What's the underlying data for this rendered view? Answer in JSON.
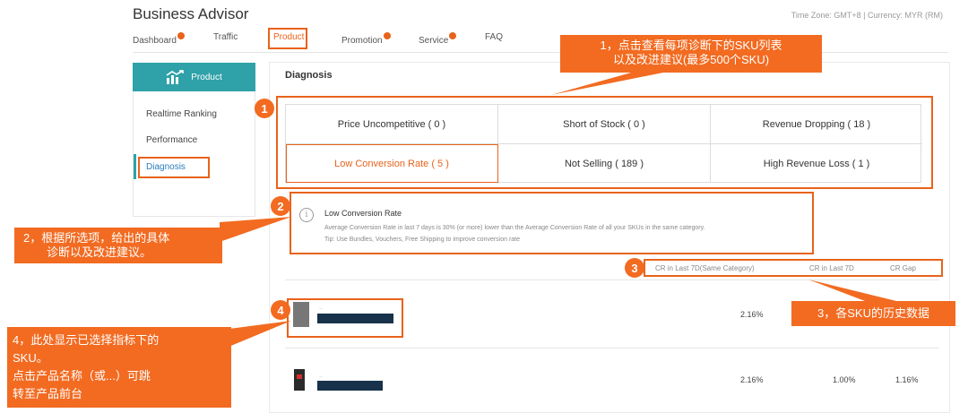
{
  "header": {
    "title": "Business Advisor",
    "meta": "Time Zone: GMT+8 | Currency: MYR (RM)"
  },
  "nav": {
    "dashboard": "Dashboard",
    "traffic": "Traffic",
    "product": "Product",
    "promotion": "Promotion",
    "service": "Service",
    "faq": "FAQ"
  },
  "sidebar": {
    "head": "Product",
    "items": [
      "Realtime Ranking",
      "Performance",
      "Diagnosis"
    ]
  },
  "main": {
    "title": "Diagnosis",
    "cells": [
      "Price Uncompetitive ( 0 )",
      "Short of Stock ( 0 )",
      "Revenue Dropping ( 18 )",
      "Low Conversion Rate ( 5 )",
      "Not Selling ( 189 )",
      "High Revenue Loss ( 1 )"
    ],
    "info": {
      "title": "Low Conversion Rate",
      "desc": "Average Conversion Rate in last 7 days is 30% (or more) lower than the Average Conversion Rate of all your SKUs in the same category.",
      "tip": "Tip: Use Bundles, Vouchers, Free Shipping to improve conversion rate"
    },
    "columns": [
      "CR in Last 7D(Same Category)",
      "CR in Last 7D",
      "CR Gap"
    ],
    "rows": [
      {
        "small": "....",
        "cat": "2.16%",
        "cr": "",
        "gap": ""
      },
      {
        "small": "....",
        "cat": "2.16%",
        "cr": "1.00%",
        "gap": "1.16%"
      }
    ]
  },
  "annotations": {
    "badges": [
      "1",
      "2",
      "3",
      "4"
    ],
    "c1_line1": "1，点击查看每项诊断下的SKU列表",
    "c1_line2": "以及改进建议(最多500个SKU)",
    "c2_line1": "2，根据所选项，给出的具体",
    "c2_line2": "诊断以及改进建议。",
    "c3": "3，各SKU的历史数据",
    "c4_line1": "4，此处显示已选择指标下的",
    "c4_line2": "SKU。",
    "c4_line3": "点击产品名称（或...）可跳",
    "c4_line4": "转至产品前台"
  },
  "colors": {
    "accent": "#f26b21",
    "teal": "#2fa1a8"
  }
}
